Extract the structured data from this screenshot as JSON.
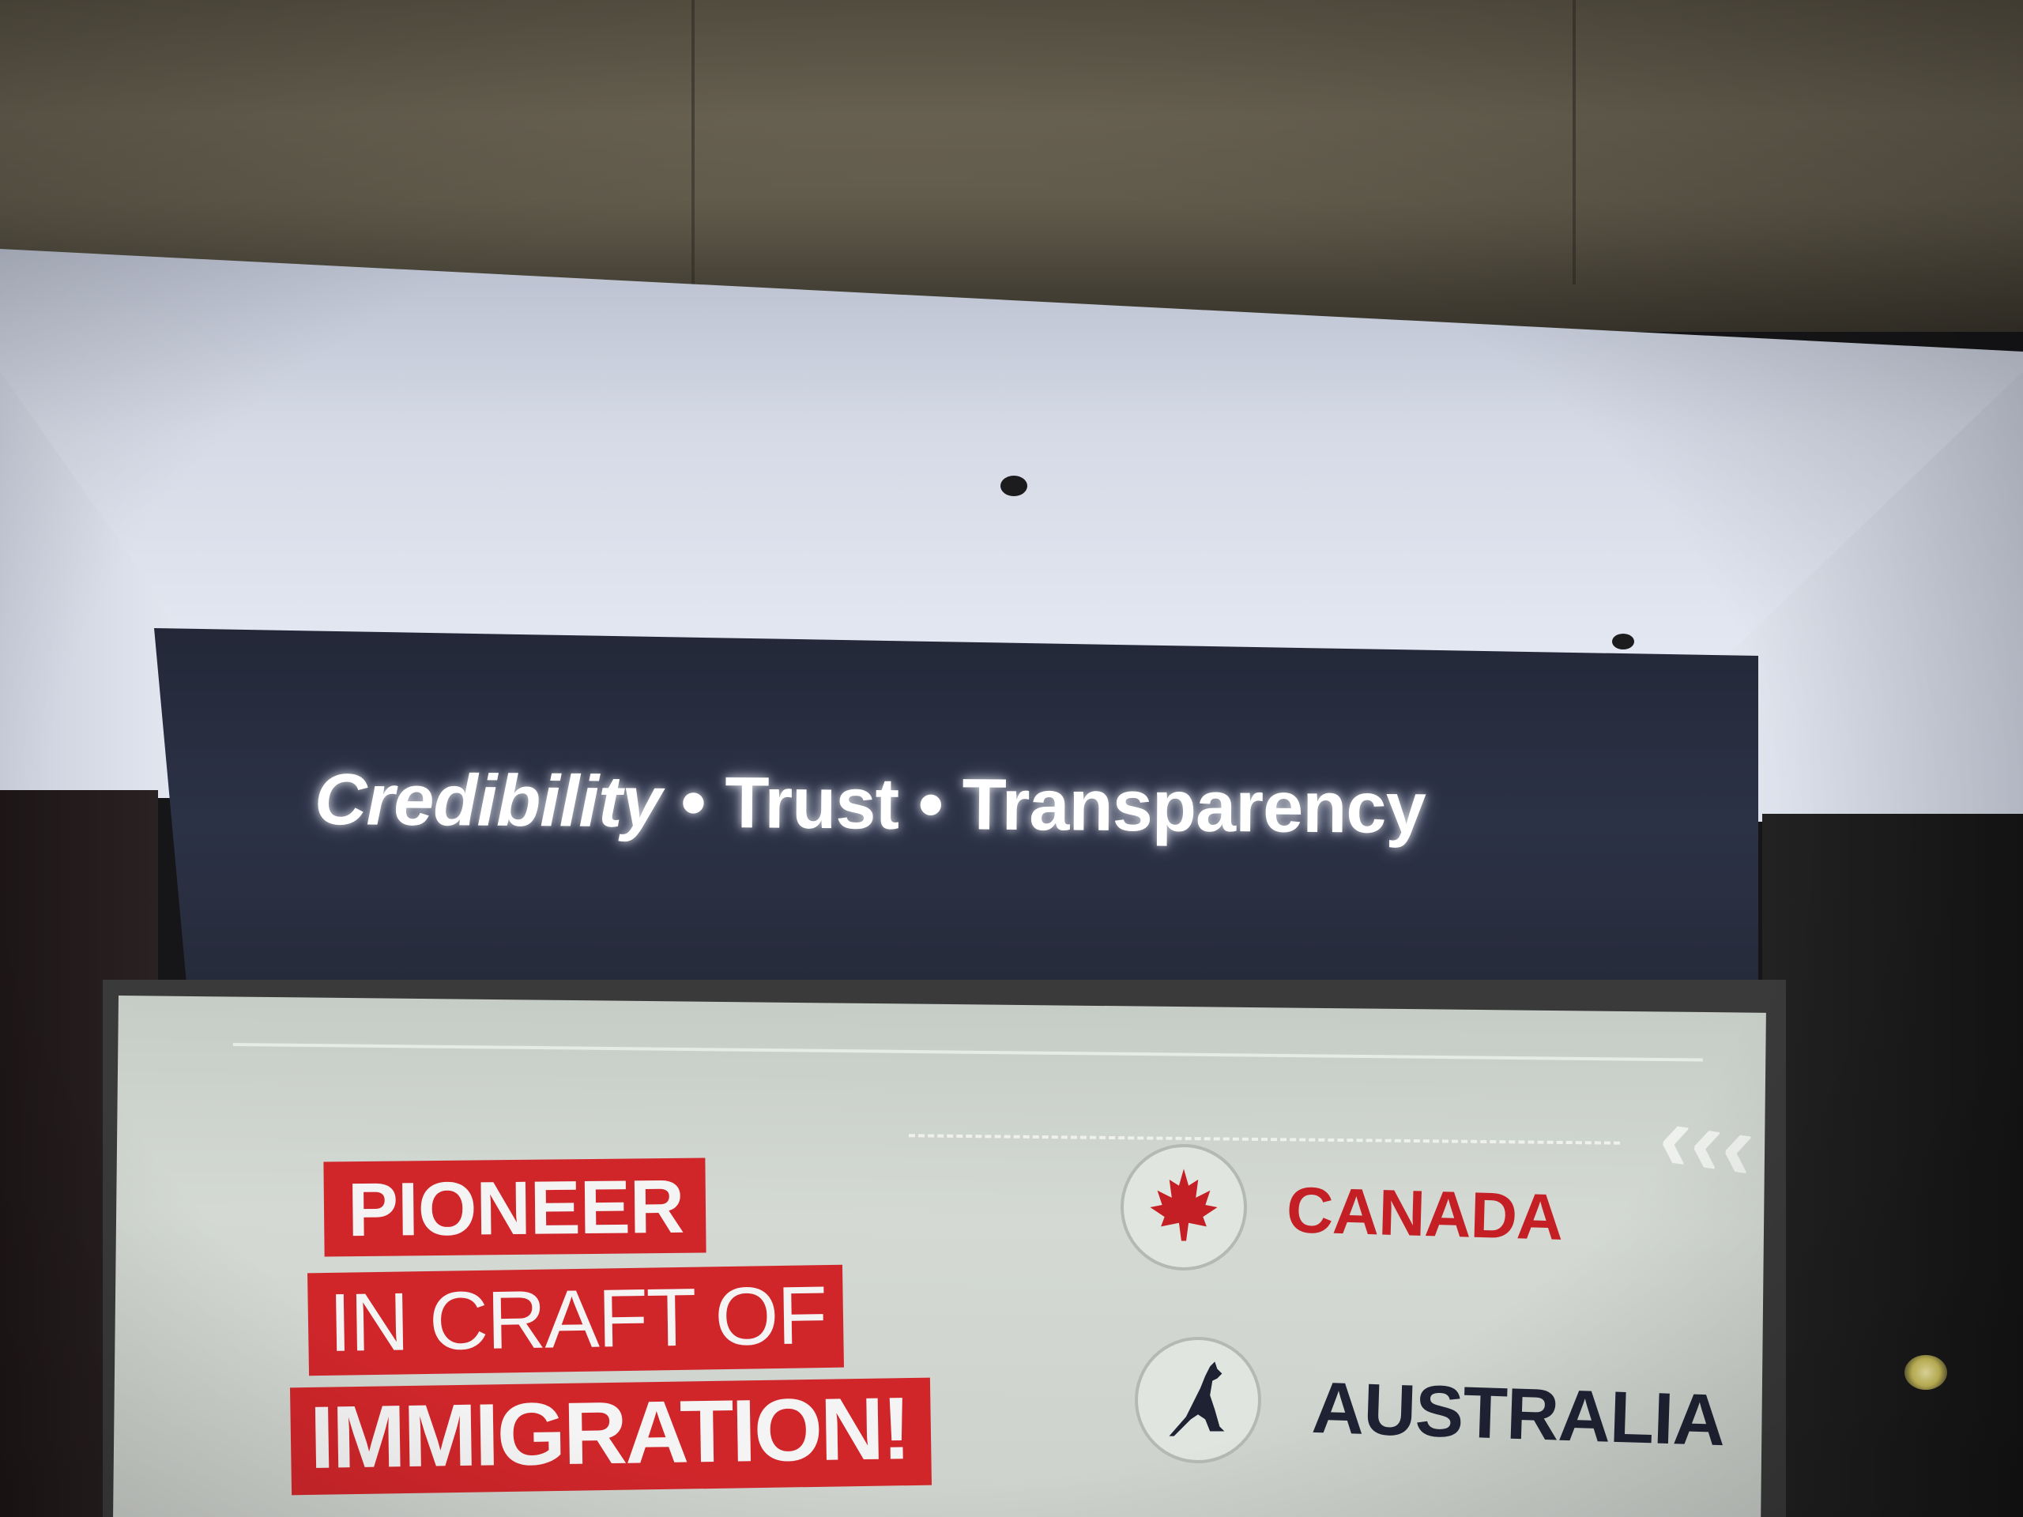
{
  "sign": {
    "word1": "Credibility",
    "separator1": "•",
    "word2": "Trust",
    "separator2": "•",
    "word3": "Transparency"
  },
  "poster": {
    "headline_line1": "PIONEER",
    "headline_line2": "IN CRAFT OF",
    "headline_line3": "IMMIGRATION!",
    "country1": "CANADA",
    "country1_icon": "maple-leaf-icon",
    "country2": "AUSTRALIA",
    "country2_icon": "kangaroo-icon"
  },
  "colors": {
    "headline_red": "#d0262a",
    "canada_red": "#c41f25",
    "australia_navy": "#1f2233",
    "sign_board": "#2a2f42",
    "soffit_white": "#dfe3ee"
  }
}
